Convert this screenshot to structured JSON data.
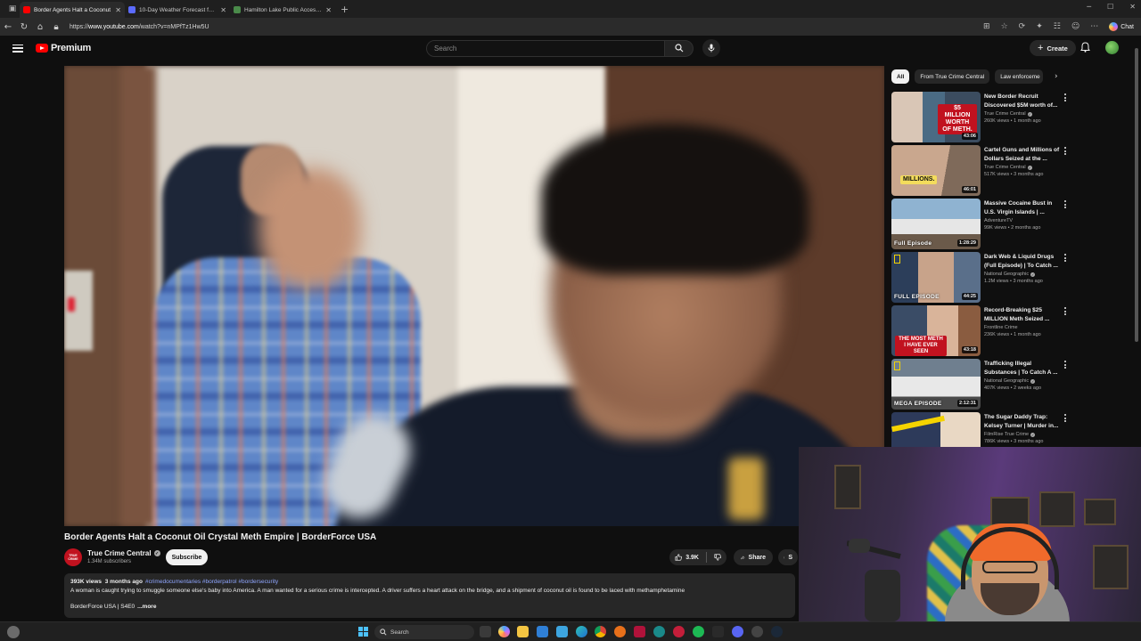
{
  "browser": {
    "tabs": [
      {
        "title": "Border Agents Halt a Coconut",
        "active": true,
        "favicon_color": "#ff0000"
      },
      {
        "title": "10-Day Weather Forecast for Fort",
        "active": false,
        "favicon_color": "#5b6bff"
      },
      {
        "title": "Hamilton Lake Public Access Site",
        "active": false,
        "favicon_color": "#4a8a4a"
      }
    ],
    "url_prefix": "https://",
    "url_host": "www.youtube.com",
    "url_path": "/watch?v=nMPfTz1Hw5U",
    "copilot_label": "Chat"
  },
  "youtube": {
    "brand": "Premium",
    "search_placeholder": "Search",
    "create_label": "Create"
  },
  "video": {
    "title": "Border Agents Halt a Coconut Oil Crystal Meth Empire | BorderForce USA",
    "channel": "True Crime Central",
    "channel_avatar_text": "TRUE CRIME",
    "subscribers": "1.34M subscribers",
    "subscribe_label": "Subscribe",
    "likes": "3.9K",
    "share_label": "Share",
    "save_label": "S"
  },
  "description": {
    "views": "393K views",
    "age": "3 months ago",
    "hashtags": "#crimedocumentaries #borderpatrol #bordersecurity",
    "text": "A woman is caught trying to smuggle someone else's baby into America. A man wanted for a serious crime is intercepted. A driver suffers a heart attack on the bridge, and a shipment of coconut oil is found to be laced with methamphetamine",
    "footer": "BorderForce USA | S4E0",
    "more_label": "...more"
  },
  "sidebar": {
    "chips": [
      "All",
      "From True Crime Central",
      "Law enforceme"
    ],
    "recommendations": [
      {
        "title": "New Border Recruit Discovered $5M worth of...",
        "channel": "True Crime Central",
        "verified": true,
        "views": "260K views",
        "age": "1 month ago",
        "duration": "43:06",
        "overlay": "$5 MILLION WORTH OF METH.",
        "tag": ""
      },
      {
        "title": "Cartel Guns and Millions of Dollars Seized at the ...",
        "channel": "True Crime Central",
        "verified": true,
        "views": "517K views",
        "age": "3 months ago",
        "duration": "46:01",
        "overlay": "MILLIONS.",
        "tag": ""
      },
      {
        "title": "Massive Cocaine Bust in U.S. Virgin Islands | ...",
        "channel": "AdventureTV",
        "verified": false,
        "views": "99K views",
        "age": "2 months ago",
        "duration": "1:28:29",
        "overlay": "",
        "tag": "Full Episode"
      },
      {
        "title": "Dark Web & Liquid Drugs (Full Episode) | To Catch ...",
        "channel": "National Geographic",
        "verified": true,
        "views": "1.2M views",
        "age": "3 months ago",
        "duration": "44:25",
        "overlay": "",
        "tag": "FULL EPISODE"
      },
      {
        "title": "Record-Breaking $25 MILLION Meth Seized ...",
        "channel": "Frontline Crime",
        "verified": false,
        "views": "236K views",
        "age": "1 month ago",
        "duration": "43:18",
        "overlay": "THE MOST METH I HAVE EVER SEEN",
        "tag": ""
      },
      {
        "title": "Trafficking Illegal Substances | To Catch A ...",
        "channel": "National Geographic",
        "verified": true,
        "views": "407K views",
        "age": "2 weeks ago",
        "duration": "2:12:31",
        "overlay": "",
        "tag": "MEGA EPISODE"
      },
      {
        "title": "The Sugar Daddy Trap: Kelsey Turner | Murder in...",
        "channel": "FilmRise True Crime",
        "verified": true,
        "views": "786K views",
        "age": "3 months ago",
        "duration": "",
        "overlay": "",
        "tag": ""
      }
    ]
  },
  "taskbar": {
    "search_label": "Search"
  },
  "colors": {
    "accent_red": "#ff0000",
    "background": "#0f0f0f",
    "chip_bg": "#272727",
    "link_blue": "#8fa6ff"
  }
}
